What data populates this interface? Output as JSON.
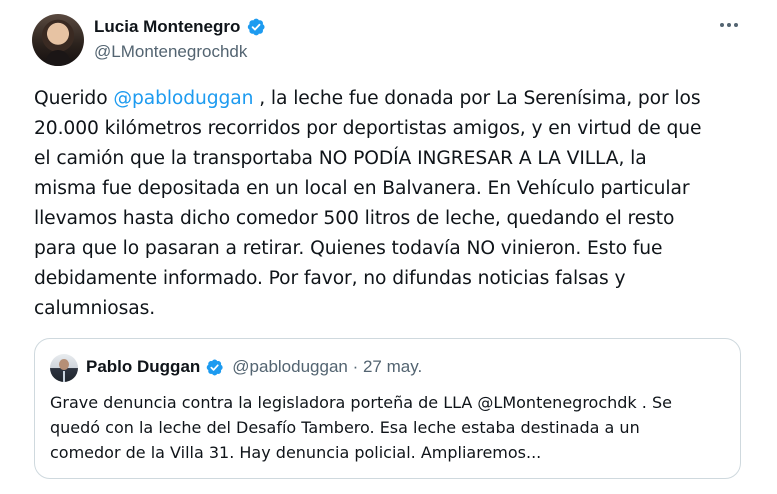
{
  "author": {
    "name": "Lucia Montenegro",
    "handle": "@LMontenegrochdk",
    "verified": true,
    "verified_color": "#1d9bf0"
  },
  "more_icon": "more-horizontal-icon",
  "tweet": {
    "lines": [
      {
        "pre": "Querido ",
        "mention": "@pabloduggan",
        "post": " , la leche fue donada por La Serenísima, por los"
      },
      {
        "text": "20.000 kilómetros recorridos por deportistas amigos, y en virtud de que"
      },
      {
        "text": "el camión que la transportaba NO PODÍA INGRESAR A LA VILLA, la"
      },
      {
        "text": "misma fue depositada en un local en Balvanera. En Vehículo particular"
      },
      {
        "text": "llevamos hasta dicho comedor 500 litros de leche, quedando el resto"
      },
      {
        "text": "para que lo pasaran a retirar. Quienes todavía NO vinieron. Esto fue"
      },
      {
        "text": "debidamente informado. Por favor, no difundas noticias falsas y"
      },
      {
        "text": "calumniosas."
      }
    ]
  },
  "quoted": {
    "name": "Pablo Duggan",
    "verified": true,
    "meta": "@pabloduggan · 27 may.",
    "lines": [
      "Grave denuncia contra la legisladora porteña de LLA @LMontenegrochdk . Se",
      "quedó con la leche del Desafío Tambero. Esa leche estaba destinada a un",
      "comedor de la Villa 31. Hay denuncia policial. Ampliaremos..."
    ]
  },
  "colors": {
    "text": "#0f1419",
    "secondary": "#536471",
    "link": "#1d9bf0",
    "border": "#cfd9de"
  }
}
